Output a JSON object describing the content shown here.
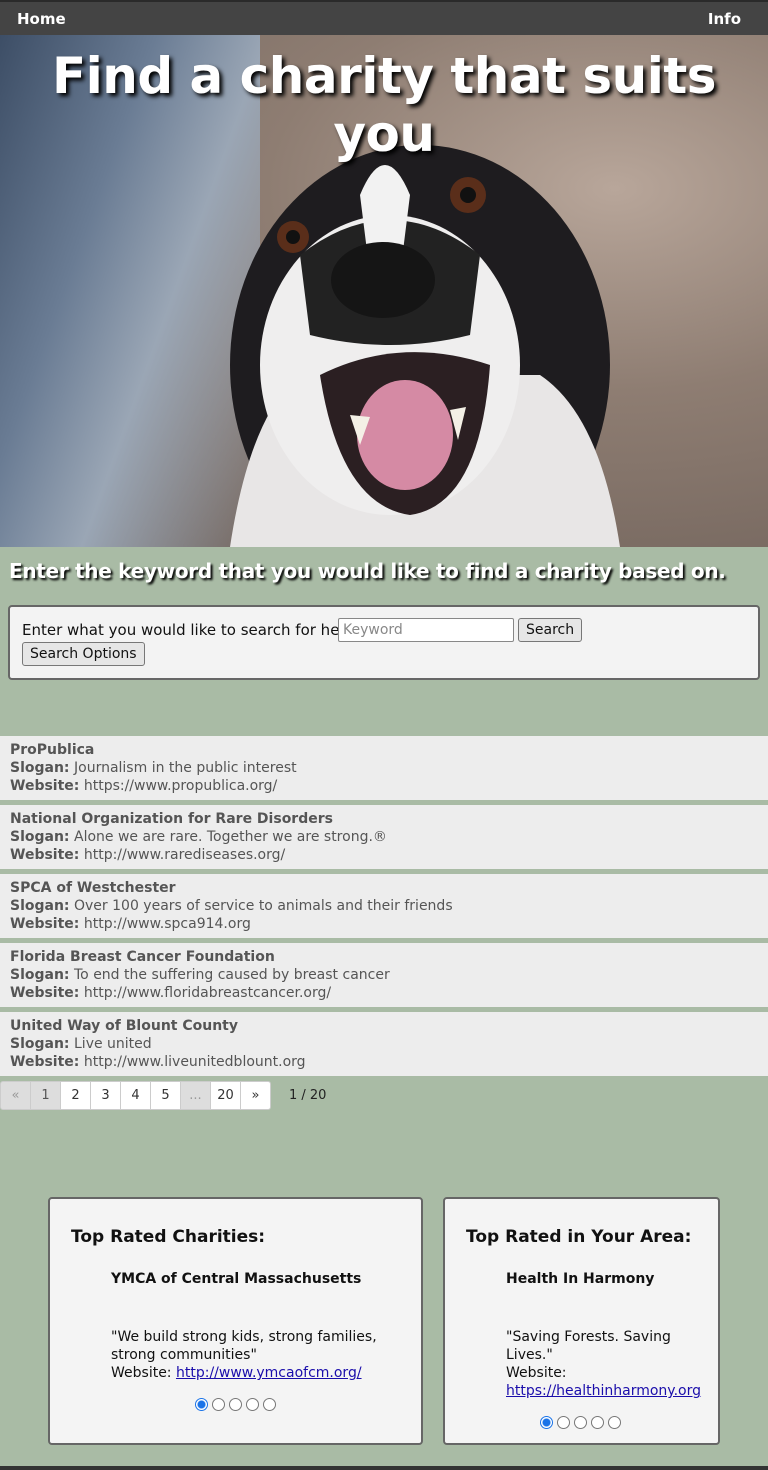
{
  "nav": {
    "home": "Home",
    "info": "Info"
  },
  "hero": {
    "title": "Find a charity that suits you"
  },
  "instruction": "Enter the keyword that you would like to find a charity based on.",
  "search": {
    "label": "Enter what you would like to search for here:",
    "placeholder": "Keyword",
    "value": "",
    "search_button": "Search",
    "options_button": "Search Options"
  },
  "results": [
    {
      "name": "ProPublica",
      "slogan_key": "Slogan:",
      "slogan": "Journalism in the public interest",
      "website_key": "Website:",
      "website": "https://www.propublica.org/"
    },
    {
      "name": "National Organization for Rare Disorders",
      "slogan_key": "Slogan:",
      "slogan": "Alone we are rare. Together we are strong.®",
      "website_key": "Website:",
      "website": "http://www.rarediseases.org/"
    },
    {
      "name": "SPCA of Westchester",
      "slogan_key": "Slogan:",
      "slogan": "Over 100 years of service to animals and their friends",
      "website_key": "Website:",
      "website": "http://www.spca914.org"
    },
    {
      "name": "Florida Breast Cancer Foundation",
      "slogan_key": "Slogan:",
      "slogan": "To end the suffering caused by breast cancer",
      "website_key": "Website:",
      "website": "http://www.floridabreastcancer.org/"
    },
    {
      "name": "United Way of Blount County",
      "slogan_key": "Slogan:",
      "slogan": "Live united",
      "website_key": "Website:",
      "website": "http://www.liveunitedblount.org"
    }
  ],
  "pagination": {
    "prev": "«",
    "p1": "1",
    "p2": "2",
    "p3": "3",
    "p4": "4",
    "p5": "5",
    "ellipsis": "...",
    "last": "20",
    "next": "»",
    "count": "1 / 20"
  },
  "top_rated": {
    "title": "Top Rated Charities:",
    "name": "YMCA of Central Massachusetts",
    "slogan": "\"We build strong kids, strong families, strong communities\"",
    "website_label": "Website:",
    "website": "http://www.ymcaofcm.org/"
  },
  "top_local": {
    "title": "Top Rated in Your Area:",
    "name": "Health In Harmony",
    "slogan": "\"Saving Forests. Saving Lives.\"",
    "website_label": "Website:",
    "website": "https://healthinharmony.org"
  },
  "colors": {
    "background": "#a9bba5",
    "navbar": "#444444",
    "link": "#1a0dab",
    "radio_active": "#1a73e8"
  },
  "icons": [
    "dog-photo",
    "radio-dot"
  ]
}
